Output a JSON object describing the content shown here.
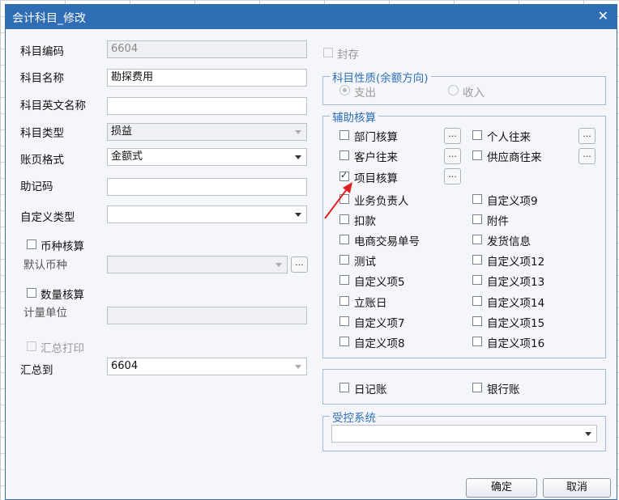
{
  "window": {
    "title": "会计科目_修改",
    "close_glyph": "✕"
  },
  "form": {
    "code": {
      "label": "科目编码",
      "value": "6604"
    },
    "name": {
      "label": "科目名称",
      "value": "勘探费用"
    },
    "english_name": {
      "label": "科目英文名称",
      "value": ""
    },
    "type": {
      "label": "科目类型",
      "value": "损益"
    },
    "ledger_format": {
      "label": "账页格式",
      "value": "金额式"
    },
    "mnemonic": {
      "label": "助记码",
      "value": ""
    },
    "custom_type": {
      "label": "自定义类型",
      "value": ""
    },
    "currency_accounting": {
      "label": "币种核算",
      "checked": false
    },
    "default_currency": {
      "label": "默认币种",
      "value": ""
    },
    "quantity_accounting": {
      "label": "数量核算",
      "checked": false
    },
    "unit": {
      "label": "计量单位",
      "value": ""
    },
    "summary_print": {
      "label": "汇总打印",
      "checked": false
    },
    "summary_to": {
      "label": "汇总到",
      "value": "6604"
    }
  },
  "right": {
    "sealed": {
      "label": "封存",
      "checked": false
    },
    "nature": {
      "title": "科目性质(余额方向)",
      "options": [
        {
          "label": "支出",
          "selected": true
        },
        {
          "label": "收入",
          "selected": false
        }
      ]
    },
    "aux": {
      "title": "辅助核算",
      "items": [
        {
          "label": "部门核算",
          "checked": false
        },
        {
          "label": "个人往来",
          "checked": false
        },
        {
          "label": "客户往来",
          "checked": false
        },
        {
          "label": "供应商往来",
          "checked": false
        },
        {
          "label": "项目核算",
          "checked": true
        },
        {
          "label": "业务负责人",
          "checked": false
        },
        {
          "label": "自定义项9",
          "checked": false
        },
        {
          "label": "扣款",
          "checked": false
        },
        {
          "label": "附件",
          "checked": false
        },
        {
          "label": "电商交易单号",
          "checked": false
        },
        {
          "label": "发货信息",
          "checked": false
        },
        {
          "label": "测试",
          "checked": false
        },
        {
          "label": "自定义项12",
          "checked": false
        },
        {
          "label": "自定义项5",
          "checked": false
        },
        {
          "label": "自定义项13",
          "checked": false
        },
        {
          "label": "立账日",
          "checked": false
        },
        {
          "label": "自定义项14",
          "checked": false
        },
        {
          "label": "自定义项7",
          "checked": false
        },
        {
          "label": "自定义项15",
          "checked": false
        },
        {
          "label": "自定义项8",
          "checked": false
        },
        {
          "label": "自定义项16",
          "checked": false
        }
      ],
      "dots_label": "..."
    },
    "journal": {
      "label": "日记账",
      "checked": false
    },
    "bank": {
      "label": "银行账",
      "checked": false
    },
    "controlled": {
      "title": "受控系统",
      "value": ""
    }
  },
  "buttons": {
    "ok": "确定",
    "cancel": "取消"
  },
  "colors": {
    "titlebar": "#2f6db5",
    "annotation_arrow": "#e02020",
    "group_title": "#2e6fb8"
  }
}
